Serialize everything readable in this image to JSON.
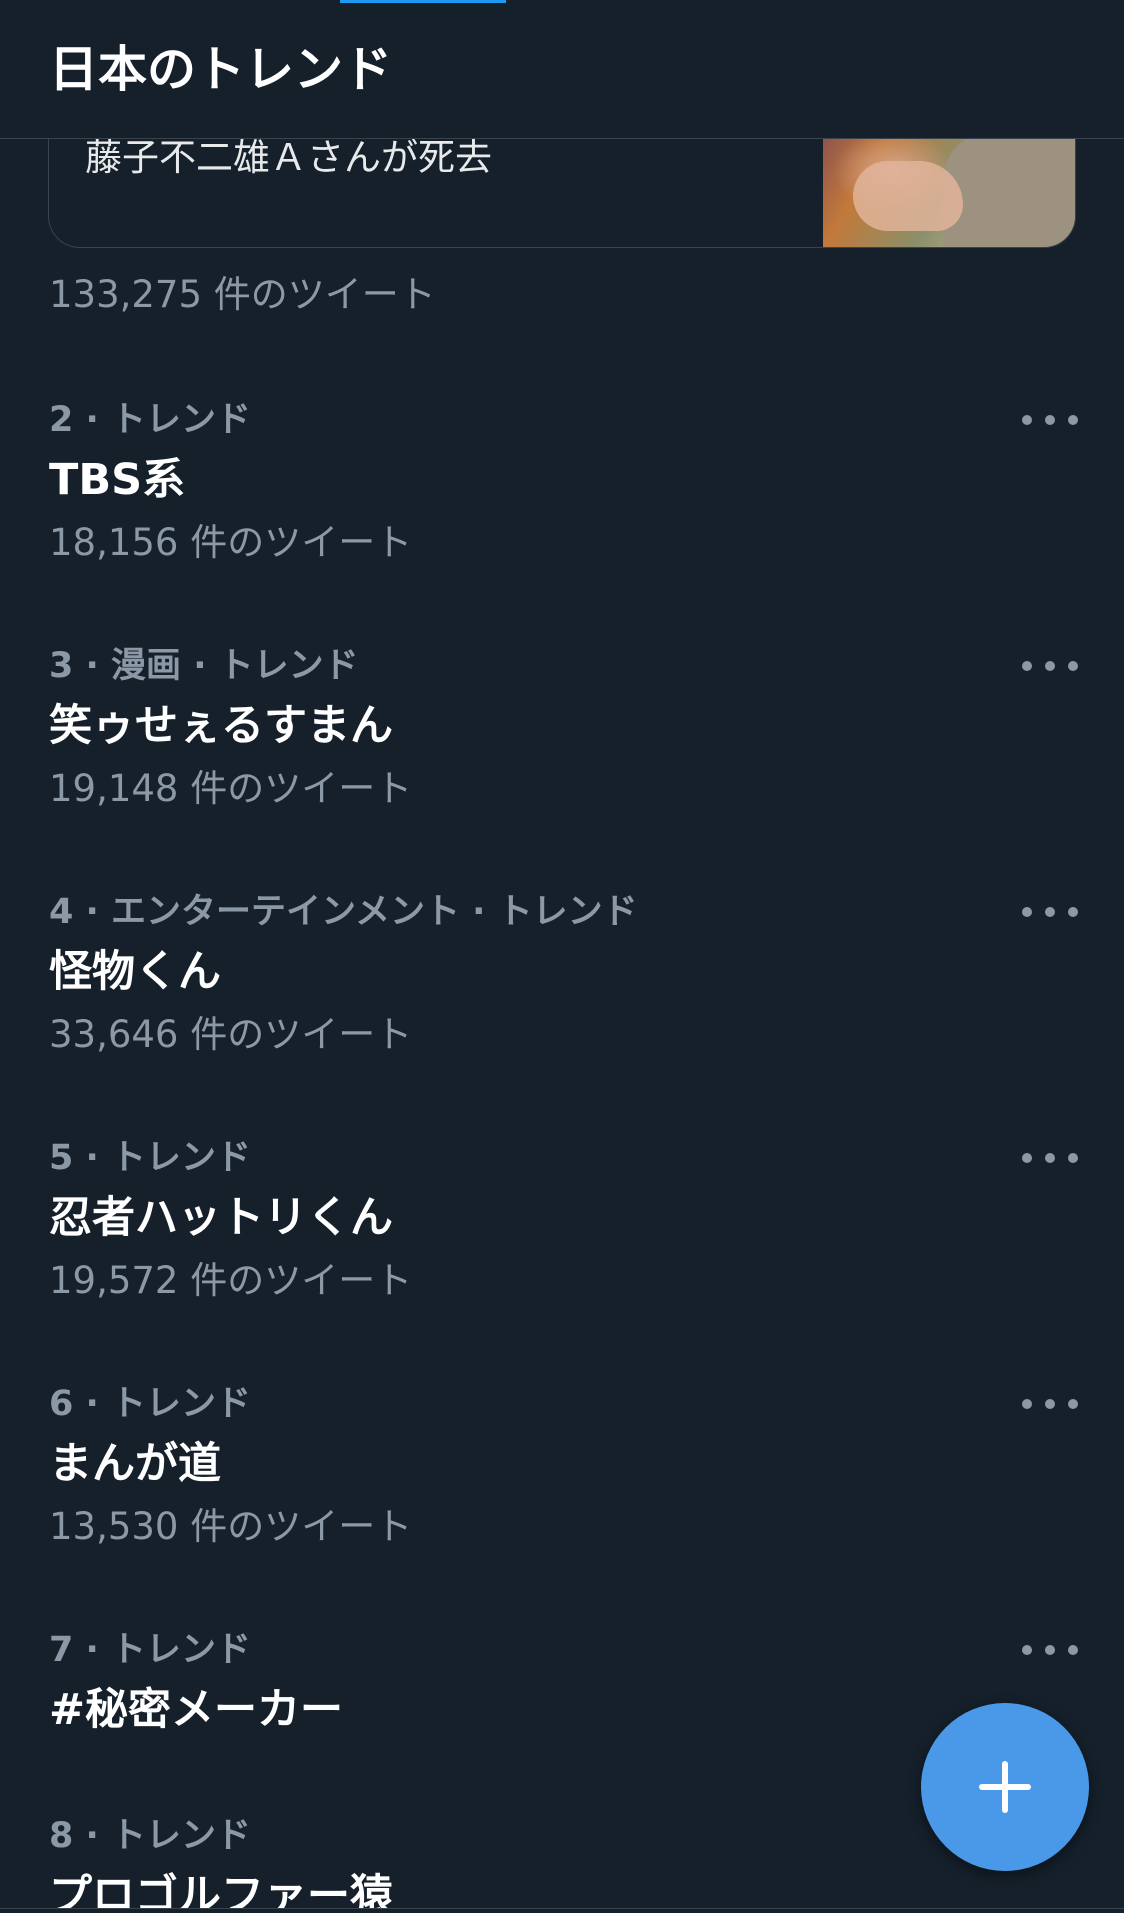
{
  "header": {
    "title": "日本のトレンド"
  },
  "featured": {
    "headline": "藤子不二雄Ａさんが死去",
    "tweet_count": "133,275 件のツイート"
  },
  "trends": [
    {
      "meta": "2 · トレンド",
      "title": "TBS系",
      "count": "18,156 件のツイート"
    },
    {
      "meta": "3 · 漫画 · トレンド",
      "title": "笑ゥせぇるすまん",
      "count": "19,148 件のツイート"
    },
    {
      "meta": "4 · エンターテインメント · トレンド",
      "title": "怪物くん",
      "count": "33,646 件のツイート"
    },
    {
      "meta": "5 · トレンド",
      "title": "忍者ハットリくん",
      "count": "19,572 件のツイート"
    },
    {
      "meta": "6 · トレンド",
      "title": "まんが道",
      "count": "13,530 件のツイート"
    },
    {
      "meta": "7 · トレンド",
      "title": "#秘密メーカー",
      "count": ""
    },
    {
      "meta": "8 · トレンド",
      "title": "プロゴルファー猿",
      "count": ""
    }
  ],
  "colors": {
    "background": "#15202b",
    "accent": "#1d9bf0",
    "fab": "#4a99e9",
    "secondary_text": "#8b98a5",
    "border": "#38444d"
  },
  "icons": {
    "more": "more-icon",
    "compose": "plus-icon"
  }
}
